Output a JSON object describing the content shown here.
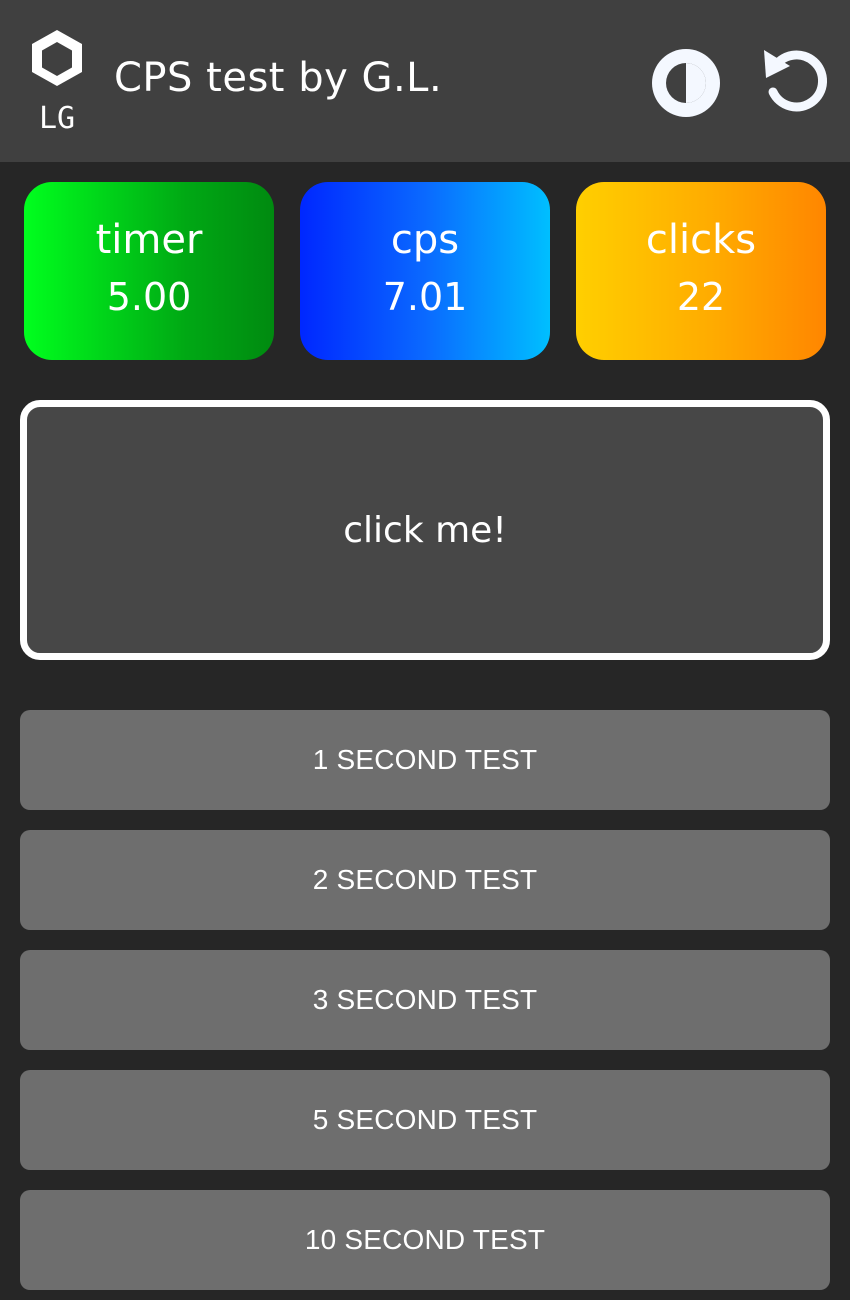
{
  "header": {
    "logo_text": "LG",
    "title": "CPS test by G.L.",
    "theme_icon": "contrast-icon",
    "reset_icon": "reset-icon"
  },
  "stats": {
    "timer": {
      "label": "timer",
      "value": "5.00",
      "color_start": "#00ff1e",
      "color_end": "#008a10"
    },
    "cps": {
      "label": "cps",
      "value": "7.01",
      "color_start": "#0027ff",
      "color_end": "#00bfff"
    },
    "clicks": {
      "label": "clicks",
      "value": "22",
      "color_start": "#ffcf00",
      "color_end": "#ff8600"
    }
  },
  "click_area": {
    "label": "click me!"
  },
  "tests": [
    {
      "label": "1 SECOND TEST"
    },
    {
      "label": "2 SECOND TEST"
    },
    {
      "label": "3 SECOND TEST"
    },
    {
      "label": "5 SECOND TEST"
    },
    {
      "label": "10 SECOND TEST"
    }
  ],
  "colors": {
    "background": "#262626",
    "header": "#404040",
    "click_area": "#474747",
    "test_button": "#6e6e6e"
  }
}
